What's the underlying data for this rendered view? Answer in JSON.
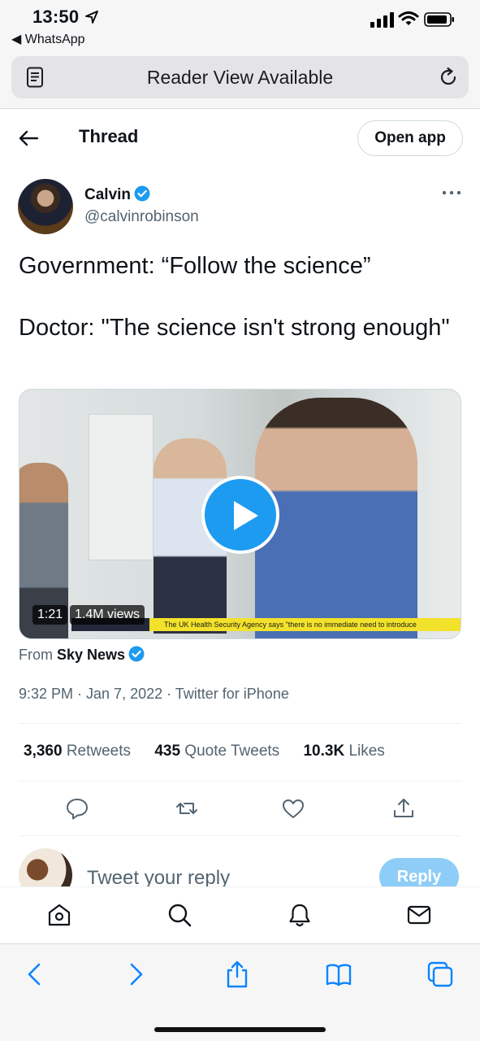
{
  "status_bar": {
    "time": "13:50",
    "back_app": "◀ WhatsApp"
  },
  "address_bar": {
    "text": "Reader View Available"
  },
  "header": {
    "title": "Thread",
    "open_app": "Open app"
  },
  "tweet": {
    "author_name": "Calvin",
    "author_handle": "@calvinrobinson",
    "text": "Government: “Follow the science”\n\nDoctor: \"The science isn't strong enough\"",
    "video": {
      "duration": "1:21",
      "views": "1.4M views",
      "ticker": "The UK Health Security Agency says \"there is no immediate need to introduce"
    },
    "from_prefix": "From",
    "from_source": "Sky News",
    "meta": "9:32 PM · Jan 7, 2022 · Twitter for iPhone",
    "stats": {
      "retweets_count": "3,360",
      "retweets_label": "Retweets",
      "quotes_count": "435",
      "quotes_label": "Quote Tweets",
      "likes_count": "10.3K",
      "likes_label": "Likes"
    }
  },
  "reply": {
    "placeholder": "Tweet your reply",
    "button": "Reply"
  },
  "colors": {
    "twitter_blue": "#1d9bf0",
    "safari_blue": "#0a84ff",
    "secondary_text": "#536471"
  },
  "icons": {
    "tab_bar": [
      "home-icon",
      "search-icon",
      "bell-icon",
      "mail-icon"
    ],
    "safari_toolbar": [
      "back-icon",
      "forward-icon",
      "share-icon",
      "bookmarks-icon",
      "tabs-icon"
    ],
    "tweet_actions": [
      "reply-icon",
      "retweet-icon",
      "like-icon",
      "share-icon"
    ]
  }
}
